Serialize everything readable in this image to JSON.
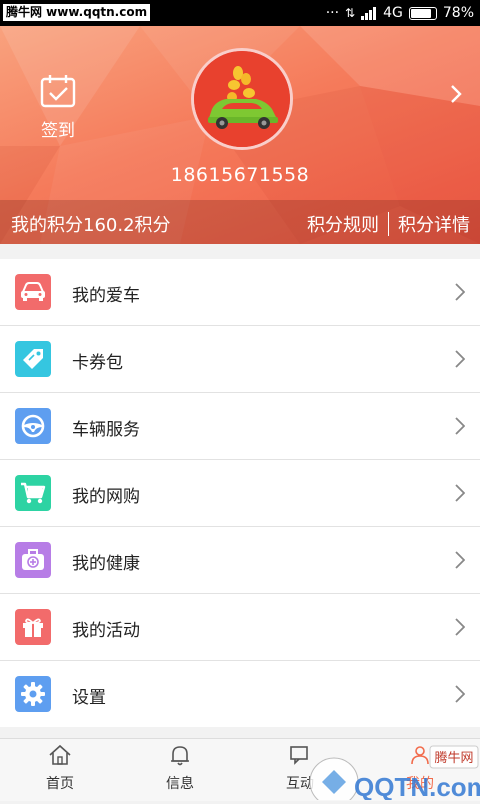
{
  "status_bar": {
    "site": "腾牛网 www.qqtn.com",
    "network": "4G",
    "battery": "78%",
    "battery_level": 0.78
  },
  "profile": {
    "signin_label": "签到",
    "phone": "18615671558"
  },
  "points": {
    "text": "我的积分160.2积分",
    "rules_link": "积分规则",
    "details_link": "积分详情"
  },
  "menu": [
    {
      "label": "我的爱车",
      "icon": "car-icon",
      "color": "#f26b6b"
    },
    {
      "label": "卡券包",
      "icon": "tag-icon",
      "color": "#35c6e0"
    },
    {
      "label": "车辆服务",
      "icon": "steering-wheel-icon",
      "color": "#5e9ef0"
    },
    {
      "label": "我的网购",
      "icon": "cart-icon",
      "color": "#2dd3a3"
    },
    {
      "label": "我的健康",
      "icon": "medkit-icon",
      "color": "#b77de6"
    },
    {
      "label": "我的活动",
      "icon": "gift-icon",
      "color": "#f26b6b"
    },
    {
      "label": "设置",
      "icon": "gear-icon",
      "color": "#5e9ef0"
    }
  ],
  "tabs": [
    {
      "label": "首页",
      "icon": "home-icon"
    },
    {
      "label": "信息",
      "icon": "bell-icon"
    },
    {
      "label": "互动",
      "icon": "chat-icon"
    },
    {
      "label": "我的",
      "icon": "person-icon"
    }
  ],
  "watermark": {
    "logo_text": "QQTN.com",
    "brand": "腾牛网"
  }
}
